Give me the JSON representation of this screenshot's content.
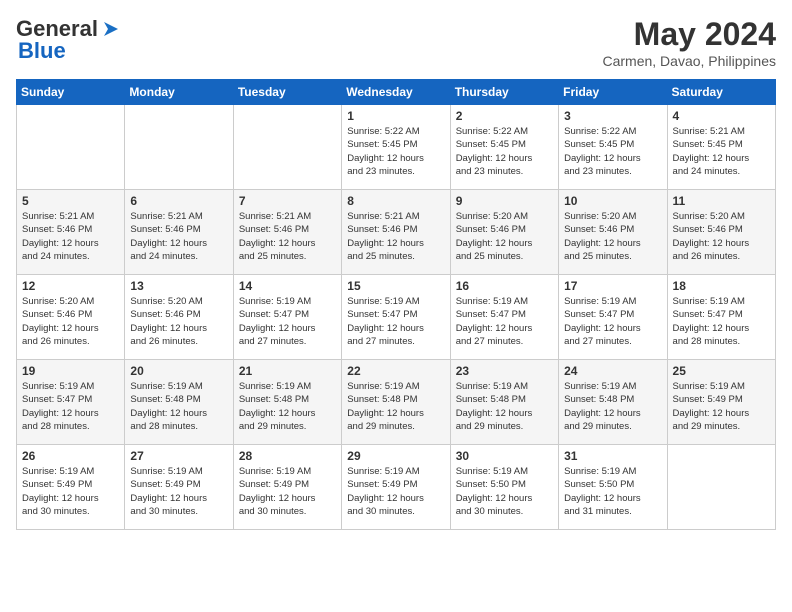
{
  "header": {
    "logo_line1": "General",
    "logo_line2": "Blue",
    "month_year": "May 2024",
    "location": "Carmen, Davao, Philippines"
  },
  "calendar": {
    "weekdays": [
      "Sunday",
      "Monday",
      "Tuesday",
      "Wednesday",
      "Thursday",
      "Friday",
      "Saturday"
    ],
    "weeks": [
      [
        {
          "day": "",
          "info": ""
        },
        {
          "day": "",
          "info": ""
        },
        {
          "day": "",
          "info": ""
        },
        {
          "day": "1",
          "info": "Sunrise: 5:22 AM\nSunset: 5:45 PM\nDaylight: 12 hours\nand 23 minutes."
        },
        {
          "day": "2",
          "info": "Sunrise: 5:22 AM\nSunset: 5:45 PM\nDaylight: 12 hours\nand 23 minutes."
        },
        {
          "day": "3",
          "info": "Sunrise: 5:22 AM\nSunset: 5:45 PM\nDaylight: 12 hours\nand 23 minutes."
        },
        {
          "day": "4",
          "info": "Sunrise: 5:21 AM\nSunset: 5:45 PM\nDaylight: 12 hours\nand 24 minutes."
        }
      ],
      [
        {
          "day": "5",
          "info": "Sunrise: 5:21 AM\nSunset: 5:46 PM\nDaylight: 12 hours\nand 24 minutes."
        },
        {
          "day": "6",
          "info": "Sunrise: 5:21 AM\nSunset: 5:46 PM\nDaylight: 12 hours\nand 24 minutes."
        },
        {
          "day": "7",
          "info": "Sunrise: 5:21 AM\nSunset: 5:46 PM\nDaylight: 12 hours\nand 25 minutes."
        },
        {
          "day": "8",
          "info": "Sunrise: 5:21 AM\nSunset: 5:46 PM\nDaylight: 12 hours\nand 25 minutes."
        },
        {
          "day": "9",
          "info": "Sunrise: 5:20 AM\nSunset: 5:46 PM\nDaylight: 12 hours\nand 25 minutes."
        },
        {
          "day": "10",
          "info": "Sunrise: 5:20 AM\nSunset: 5:46 PM\nDaylight: 12 hours\nand 25 minutes."
        },
        {
          "day": "11",
          "info": "Sunrise: 5:20 AM\nSunset: 5:46 PM\nDaylight: 12 hours\nand 26 minutes."
        }
      ],
      [
        {
          "day": "12",
          "info": "Sunrise: 5:20 AM\nSunset: 5:46 PM\nDaylight: 12 hours\nand 26 minutes."
        },
        {
          "day": "13",
          "info": "Sunrise: 5:20 AM\nSunset: 5:46 PM\nDaylight: 12 hours\nand 26 minutes."
        },
        {
          "day": "14",
          "info": "Sunrise: 5:19 AM\nSunset: 5:47 PM\nDaylight: 12 hours\nand 27 minutes."
        },
        {
          "day": "15",
          "info": "Sunrise: 5:19 AM\nSunset: 5:47 PM\nDaylight: 12 hours\nand 27 minutes."
        },
        {
          "day": "16",
          "info": "Sunrise: 5:19 AM\nSunset: 5:47 PM\nDaylight: 12 hours\nand 27 minutes."
        },
        {
          "day": "17",
          "info": "Sunrise: 5:19 AM\nSunset: 5:47 PM\nDaylight: 12 hours\nand 27 minutes."
        },
        {
          "day": "18",
          "info": "Sunrise: 5:19 AM\nSunset: 5:47 PM\nDaylight: 12 hours\nand 28 minutes."
        }
      ],
      [
        {
          "day": "19",
          "info": "Sunrise: 5:19 AM\nSunset: 5:47 PM\nDaylight: 12 hours\nand 28 minutes."
        },
        {
          "day": "20",
          "info": "Sunrise: 5:19 AM\nSunset: 5:48 PM\nDaylight: 12 hours\nand 28 minutes."
        },
        {
          "day": "21",
          "info": "Sunrise: 5:19 AM\nSunset: 5:48 PM\nDaylight: 12 hours\nand 29 minutes."
        },
        {
          "day": "22",
          "info": "Sunrise: 5:19 AM\nSunset: 5:48 PM\nDaylight: 12 hours\nand 29 minutes."
        },
        {
          "day": "23",
          "info": "Sunrise: 5:19 AM\nSunset: 5:48 PM\nDaylight: 12 hours\nand 29 minutes."
        },
        {
          "day": "24",
          "info": "Sunrise: 5:19 AM\nSunset: 5:48 PM\nDaylight: 12 hours\nand 29 minutes."
        },
        {
          "day": "25",
          "info": "Sunrise: 5:19 AM\nSunset: 5:49 PM\nDaylight: 12 hours\nand 29 minutes."
        }
      ],
      [
        {
          "day": "26",
          "info": "Sunrise: 5:19 AM\nSunset: 5:49 PM\nDaylight: 12 hours\nand 30 minutes."
        },
        {
          "day": "27",
          "info": "Sunrise: 5:19 AM\nSunset: 5:49 PM\nDaylight: 12 hours\nand 30 minutes."
        },
        {
          "day": "28",
          "info": "Sunrise: 5:19 AM\nSunset: 5:49 PM\nDaylight: 12 hours\nand 30 minutes."
        },
        {
          "day": "29",
          "info": "Sunrise: 5:19 AM\nSunset: 5:49 PM\nDaylight: 12 hours\nand 30 minutes."
        },
        {
          "day": "30",
          "info": "Sunrise: 5:19 AM\nSunset: 5:50 PM\nDaylight: 12 hours\nand 30 minutes."
        },
        {
          "day": "31",
          "info": "Sunrise: 5:19 AM\nSunset: 5:50 PM\nDaylight: 12 hours\nand 31 minutes."
        },
        {
          "day": "",
          "info": ""
        }
      ]
    ]
  }
}
